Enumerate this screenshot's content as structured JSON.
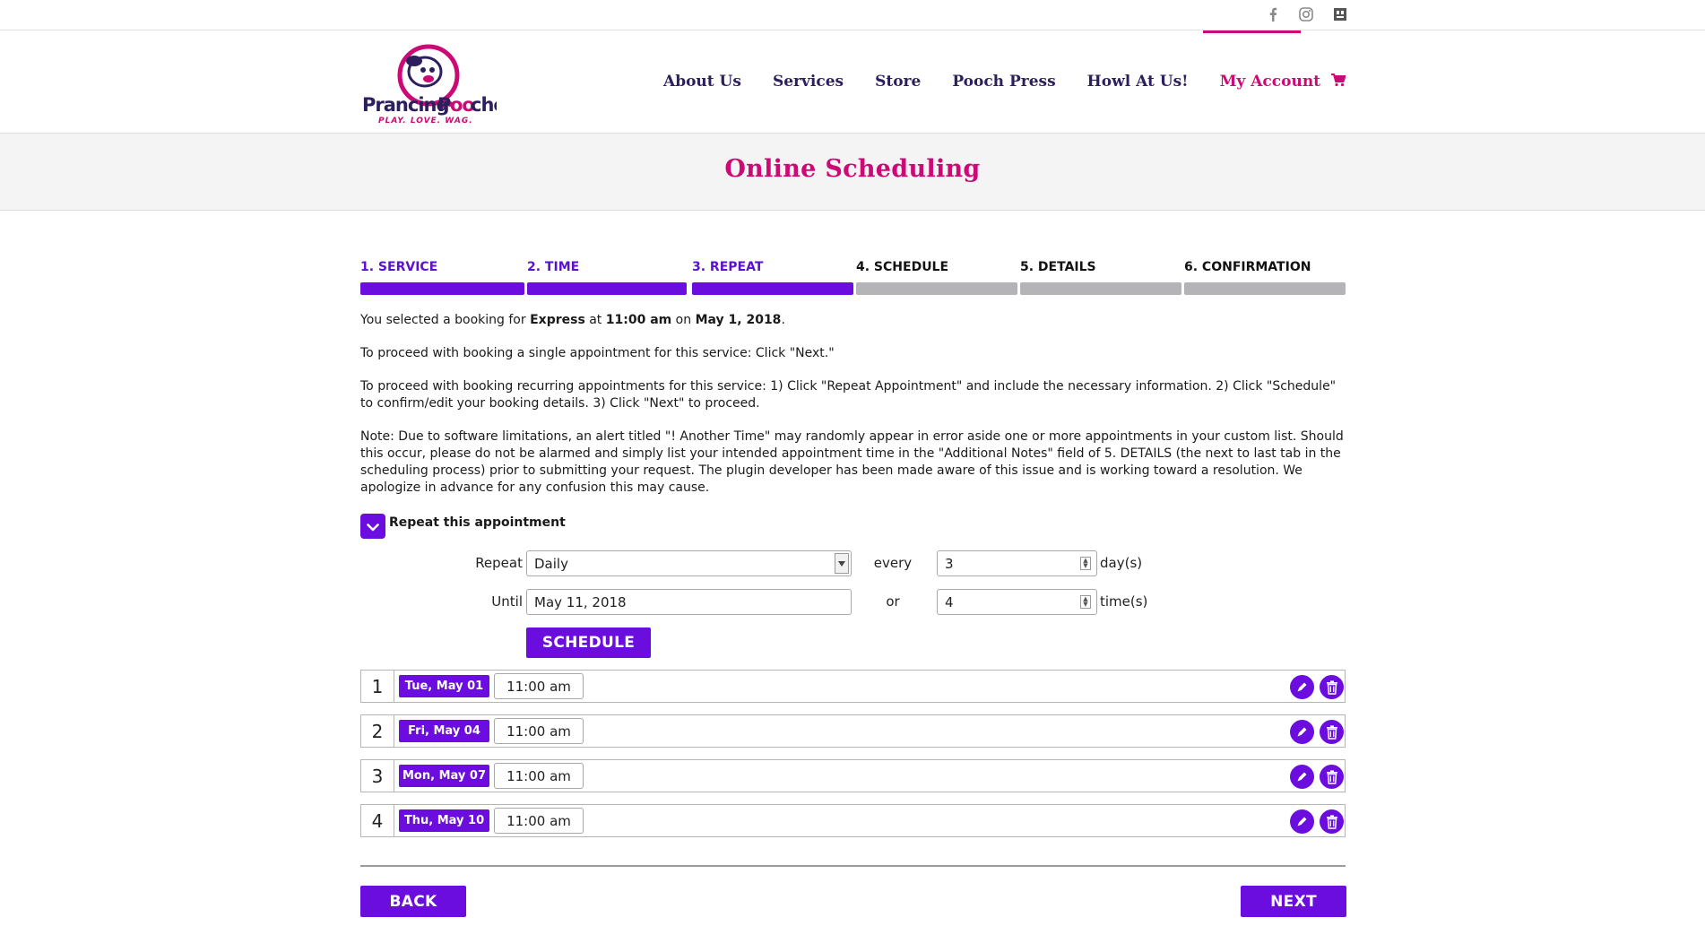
{
  "topbar": {
    "social": [
      "facebook-icon",
      "instagram-icon",
      "yelp-icon"
    ]
  },
  "nav": {
    "items": [
      "About Us",
      "Services",
      "Store",
      "Pooch Press",
      "Howl At Us!",
      "My Account"
    ],
    "active": "My Account"
  },
  "logo": {
    "name": "Prancing Pooches",
    "tagline": "PLAY. LOVE. WAG."
  },
  "page_title": "Online Scheduling",
  "steps": [
    {
      "label": "1. SERVICE",
      "done": true
    },
    {
      "label": "2. TIME",
      "done": true
    },
    {
      "label": "3. REPEAT",
      "done": true
    },
    {
      "label": "4. SCHEDULE",
      "done": false
    },
    {
      "label": "5. DETAILS",
      "done": false
    },
    {
      "label": "6. CONFIRMATION",
      "done": false
    }
  ],
  "selection": {
    "prefix": "You selected a booking for ",
    "service": "Express",
    "at": " at ",
    "time": "11:00 am",
    "on": " on ",
    "date": "May 1, 2018",
    "suffix": "."
  },
  "info": {
    "single": "To proceed with booking a single appointment for this service: Click \"Next.\"",
    "recurring": "To proceed with booking recurring appointments for this service: 1) Click \"Repeat Appointment\" and include the necessary information. 2) Click \"Schedule\" to confirm/edit your booking details. 3) Click \"Next\" to proceed.",
    "note": "Note: Due to software limitations, an alert titled \"! Another Time\" may randomly appear in error aside one or more appointments in your custom list. Should this occur, please do not be alarmed and simply list your intended appointment time in the \"Additional Notes\" field of 5. DETAILS (the next to last tab in the scheduling process) prior to submitting your request. The plugin developer has been made aware of this issue and is working toward a resolution. We apologize in advance for any confusion this may cause."
  },
  "repeat": {
    "title": "Repeat this appointment",
    "repeat_label": "Repeat",
    "repeat_value": "Daily",
    "every_label": "every",
    "every_value": "3",
    "every_unit": "day(s)",
    "until_label": "Until",
    "until_value": "May 11, 2018",
    "or_label": "or",
    "times_value": "4",
    "times_unit": "time(s)",
    "schedule_button": "SCHEDULE"
  },
  "appointments": [
    {
      "num": "1",
      "date": "Tue, May 01",
      "time": "11:00 am"
    },
    {
      "num": "2",
      "date": "Fri, May 04",
      "time": "11:00 am"
    },
    {
      "num": "3",
      "date": "Mon, May 07",
      "time": "11:00 am"
    },
    {
      "num": "4",
      "date": "Thu, May 10",
      "time": "11:00 am"
    }
  ],
  "footer": {
    "back": "BACK",
    "next": "NEXT"
  },
  "colors": {
    "purple": "#6a0dde",
    "pink": "#cc0a76",
    "navy": "#2d1f5e"
  }
}
